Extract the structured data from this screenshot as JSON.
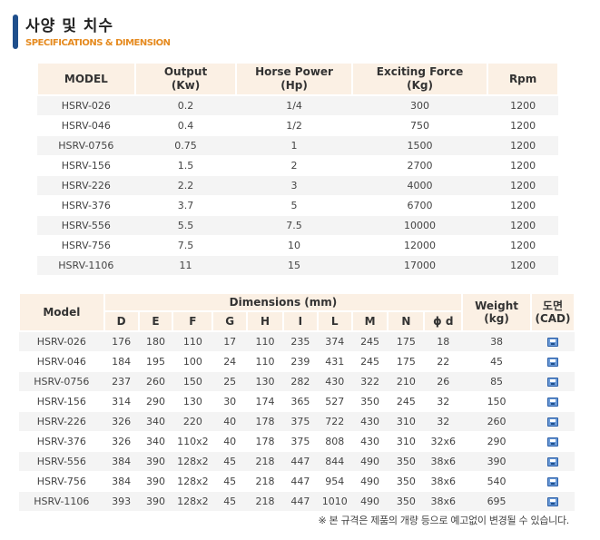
{
  "header": {
    "title": "사양 및 치수",
    "subtitle": "SPECIFICATIONS & DIMENSION"
  },
  "spec": {
    "columns": [
      "MODEL",
      "Output\n(Kw)",
      "Horse Power\n(Hp)",
      "Exciting Force\n(Kg)",
      "Rpm"
    ],
    "rows": [
      [
        "HSRV-026",
        "0.2",
        "1/4",
        "300",
        "1200"
      ],
      [
        "HSRV-046",
        "0.4",
        "1/2",
        "750",
        "1200"
      ],
      [
        "HSRV-0756",
        "0.75",
        "1",
        "1500",
        "1200"
      ],
      [
        "HSRV-156",
        "1.5",
        "2",
        "2700",
        "1200"
      ],
      [
        "HSRV-226",
        "2.2",
        "3",
        "4000",
        "1200"
      ],
      [
        "HSRV-376",
        "3.7",
        "5",
        "6700",
        "1200"
      ],
      [
        "HSRV-556",
        "5.5",
        "7.5",
        "10000",
        "1200"
      ],
      [
        "HSRV-756",
        "7.5",
        "10",
        "12000",
        "1200"
      ],
      [
        "HSRV-1106",
        "11",
        "15",
        "17000",
        "1200"
      ]
    ]
  },
  "dimension": {
    "model_label": "Model",
    "group_label": "Dimensions (mm)",
    "weight_label": "Weight\n(kg)",
    "cad_label": "도면\n(CAD)",
    "sub_columns": [
      "D",
      "E",
      "F",
      "G",
      "H",
      "I",
      "L",
      "M",
      "N",
      "ϕ d"
    ],
    "cad_icon": "save-disk-icon",
    "rows": [
      [
        "HSRV-026",
        "176",
        "180",
        "110",
        "17",
        "110",
        "235",
        "374",
        "245",
        "175",
        "18",
        "38"
      ],
      [
        "HSRV-046",
        "184",
        "195",
        "100",
        "24",
        "110",
        "239",
        "431",
        "245",
        "175",
        "22",
        "45"
      ],
      [
        "HSRV-0756",
        "237",
        "260",
        "150",
        "25",
        "130",
        "282",
        "430",
        "322",
        "210",
        "26",
        "85"
      ],
      [
        "HSRV-156",
        "314",
        "290",
        "130",
        "30",
        "174",
        "365",
        "527",
        "350",
        "245",
        "32",
        "150"
      ],
      [
        "HSRV-226",
        "326",
        "340",
        "220",
        "40",
        "178",
        "375",
        "722",
        "430",
        "310",
        "32",
        "260"
      ],
      [
        "HSRV-376",
        "326",
        "340",
        "110x2",
        "40",
        "178",
        "375",
        "808",
        "430",
        "310",
        "32x6",
        "290"
      ],
      [
        "HSRV-556",
        "384",
        "390",
        "128x2",
        "45",
        "218",
        "447",
        "844",
        "490",
        "350",
        "38x6",
        "390"
      ],
      [
        "HSRV-756",
        "384",
        "390",
        "128x2",
        "45",
        "218",
        "447",
        "954",
        "490",
        "350",
        "38x6",
        "540"
      ],
      [
        "HSRV-1106",
        "393",
        "390",
        "128x2",
        "45",
        "218",
        "447",
        "1010",
        "490",
        "350",
        "38x6",
        "695"
      ]
    ]
  },
  "note": "※ 본 규격은 제품의 개량 등으로 예고없이 변경될 수 있습니다.",
  "colors": {
    "header_bg": "#fbf0e4",
    "row_alt": "#f4f4f4",
    "accent_bar": "#1f4f8c",
    "subtitle": "#e58a1f"
  }
}
